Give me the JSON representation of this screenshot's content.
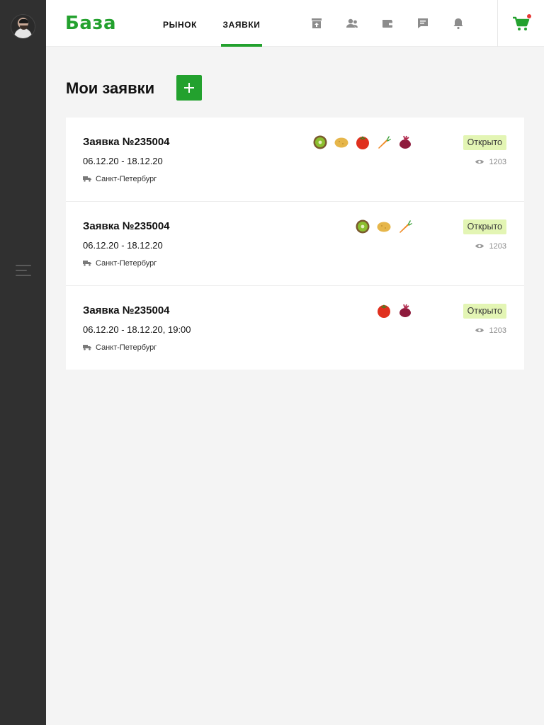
{
  "app": {
    "logo_text": "База",
    "brand_color": "#23a12e"
  },
  "header": {
    "tabs": [
      {
        "label": "РЫНОК",
        "active": false
      },
      {
        "label": "ЗАЯВКИ",
        "active": true
      }
    ],
    "icons": [
      "archive-icon",
      "users-icon",
      "wallet-icon",
      "messages-icon",
      "bell-icon"
    ],
    "cart": {
      "icon": "cart-icon",
      "has_notification": true
    }
  },
  "page": {
    "title": "Мои заявки",
    "add_label": "+"
  },
  "orders": [
    {
      "title": "Заявка №235004",
      "dates": "06.12.20 - 18.12.20",
      "city": "Санкт-Петербург",
      "status": "Открыто",
      "views": "1203",
      "produce": [
        "kiwi",
        "potato",
        "tomato",
        "carrot",
        "beet"
      ]
    },
    {
      "title": "Заявка №235004",
      "dates": "06.12.20 - 18.12.20",
      "city": "Санкт-Петербург",
      "status": "Открыто",
      "views": "1203",
      "produce": [
        "kiwi",
        "potato",
        "carrot"
      ]
    },
    {
      "title": "Заявка №235004",
      "dates": "06.12.20 - 18.12.20, 19:00",
      "city": "Санкт-Петербург",
      "status": "Открыто",
      "views": "1203",
      "produce": [
        "tomato",
        "beet"
      ]
    }
  ]
}
